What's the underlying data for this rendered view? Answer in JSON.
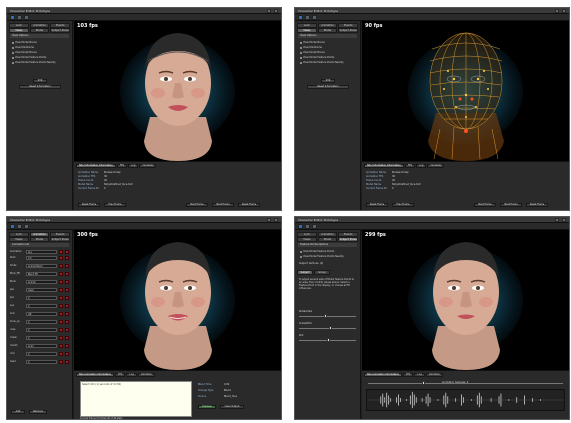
{
  "app": {
    "title": "Character Editor Prototype"
  },
  "windows": [
    {
      "fps": "103 fps",
      "left_tabs": [
        "Look",
        "Animation",
        "Events",
        "Views",
        "Model",
        "Subject Poses"
      ],
      "section": "View Options",
      "checkboxes": [
        {
          "label": "View Model Bones",
          "checked": false
        },
        {
          "label": "View Wireframe",
          "checked": false
        },
        {
          "label": "View Model Bones",
          "checked": false
        },
        {
          "label": "View Model Feature Points",
          "checked": false
        },
        {
          "label": "View Model Feature Points Nearby",
          "checked": false
        }
      ],
      "button_small": "XYZ",
      "button_main": "Reset Information",
      "bottom_tabs": [
        "Site Information Information",
        "FPS",
        "Log",
        "Variables"
      ],
      "props": [
        {
          "k": "Animation Name",
          "v": "Bodeanimdap"
        },
        {
          "k": "Animation FPS",
          "v": "30"
        },
        {
          "k": "Frame Count",
          "v": "40"
        },
        {
          "k": "Model Name",
          "v": "Notyetdefined_face.0x0"
        },
        {
          "k": "Current Frame Nr",
          "v": "0"
        }
      ],
      "bottom_buttons": [
        "Reset Frame",
        "Prev Frame",
        "Next Frame",
        "Next Frame",
        "Reset Frame"
      ]
    },
    {
      "fps": "90 fps",
      "left_tabs": [
        "Look",
        "Animation",
        "Events",
        "Views",
        "Model",
        "Subject Poses"
      ],
      "section": "View Options",
      "checkboxes": [
        {
          "label": "View Model Bones",
          "checked": true
        },
        {
          "label": "View Wireframe",
          "checked": true
        },
        {
          "label": "View Model Bones",
          "checked": true
        },
        {
          "label": "View Model Feature Points",
          "checked": true
        },
        {
          "label": "View Model Feature Points Nearby",
          "checked": true
        }
      ],
      "button_small": "XYZ",
      "button_main": "Reset Information",
      "bottom_tabs": [
        "Site Information Information",
        "FPS",
        "Log",
        "Variables"
      ],
      "props": [
        {
          "k": "Animation Name",
          "v": "Bodeanimdap"
        },
        {
          "k": "Animation FPS",
          "v": "30"
        },
        {
          "k": "Frame Count",
          "v": "40"
        },
        {
          "k": "Model Name",
          "v": "Notyetdefined_face.0x0"
        },
        {
          "k": "Current Frame Nr",
          "v": "0"
        }
      ],
      "bottom_buttons": [
        "Reset Frame",
        "Prev Frame",
        "Next Frame",
        "Next Frame",
        "Reset Frame"
      ]
    },
    {
      "fps": "300 fps",
      "left_tabs": [
        "Look",
        "Animation",
        "Events",
        "Views",
        "Model",
        "Subject Poses"
      ],
      "section": "Animation list",
      "anim_rows": [
        {
          "name": "Animation",
          "value": "ALL"
        },
        {
          "name": "blink",
          "value": "0.5"
        },
        {
          "name": "Smile",
          "value": "Animal Blend"
        },
        {
          "name": "Blink_FB",
          "value": "Blend FB"
        },
        {
          "name": "Brow",
          "value": "Animal"
        },
        {
          "name": "jaw",
          "value": "Open"
        },
        {
          "name": "lips",
          "value": "0"
        },
        {
          "name": "eye",
          "value": "0"
        },
        {
          "name": "look",
          "value": "left"
        },
        {
          "name": "brow_up",
          "value": "0"
        },
        {
          "name": "nose",
          "value": "0"
        },
        {
          "name": "cheek",
          "value": "0"
        },
        {
          "name": "mouth",
          "value": "Anim"
        },
        {
          "name": "chin",
          "value": "0"
        },
        {
          "name": "head",
          "value": "0"
        }
      ],
      "left_buttons": [
        "Add",
        "Remove"
      ],
      "bottom_tabs": [
        "Site Animation Information",
        "FPS",
        "Log",
        "Variables"
      ],
      "editor_text": "Select Info (1) seconds of 4 (3/2)",
      "props": [
        {
          "k": "Blend Time",
          "v": "0.00"
        },
        {
          "k": "Change Type",
          "v": "Blend"
        },
        {
          "k": "Source",
          "v": "Blend_face"
        }
      ],
      "right_buttons": [
        "Preview",
        "Clear Output"
      ],
      "footer": "Current Frame 0 Frames 40 of 40 state"
    },
    {
      "fps": "299 fps",
      "left_tabs": [
        "Look",
        "Animation",
        "Events",
        "Views",
        "Model",
        "Subject Poses"
      ],
      "section": "Feature Points Options",
      "checkboxes": [
        {
          "label": "View Model Feature Points",
          "checked": false
        },
        {
          "label": "View Model Feature Points Nearby",
          "checked": false
        }
      ],
      "subject_label": "Subject Vertices: (0)",
      "mini_tabs": [
        "Subject",
        "Group"
      ],
      "note": "To adjust several sets of Model feature Points to an area, then modify values above. Select a Feature Point in the display, or choose all FP influences.",
      "sliders": [
        {
          "label": "Rotate/Yaw",
          "value": 0.45
        },
        {
          "label": "Scale/Pitch",
          "value": 0.55
        },
        {
          "label": "Roll",
          "value": 0.5
        }
      ],
      "bottom_tabs": [
        "Site Animation Information",
        "FPS",
        "Log",
        "Variables"
      ],
      "timeline_label": "Animation Samples: 0"
    }
  ],
  "colors": {
    "window_bg": "#1f1f1f",
    "panel_bg": "#2b2b2b",
    "tab_active": "#5a5a5a",
    "glow": "#1f6b80",
    "wire": "#e8a030"
  }
}
